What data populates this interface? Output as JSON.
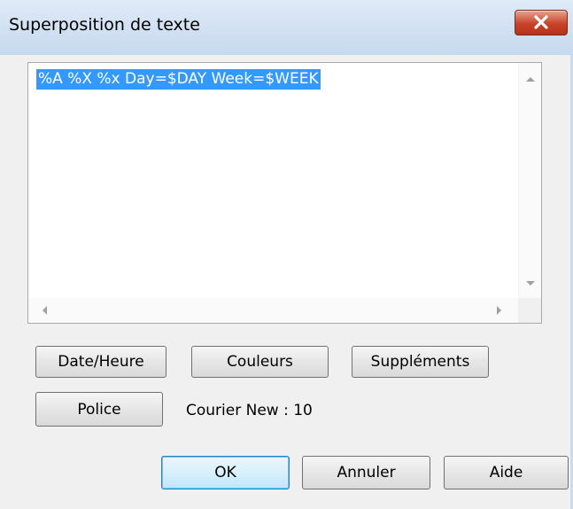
{
  "window": {
    "title": "Superposition de texte"
  },
  "editor": {
    "text": "%A %X %x Day=$DAY Week=$WEEK"
  },
  "buttons": {
    "date_time": "Date/Heure",
    "colors": "Couleurs",
    "supplements": "Suppléments",
    "font": "Police",
    "ok": "OK",
    "cancel": "Annuler",
    "help": "Aide"
  },
  "font_info": "Courier New : 10",
  "icons": {
    "close": "close-icon",
    "scroll_up": "arrow-up-icon",
    "scroll_down": "arrow-down-icon",
    "scroll_left": "arrow-left-icon",
    "scroll_right": "arrow-right-icon"
  },
  "colors": {
    "title_bar": "#c9dbee",
    "close_button": "#c8432a",
    "selection": "#3399ff",
    "dialog_background": "#f0f0f0"
  }
}
